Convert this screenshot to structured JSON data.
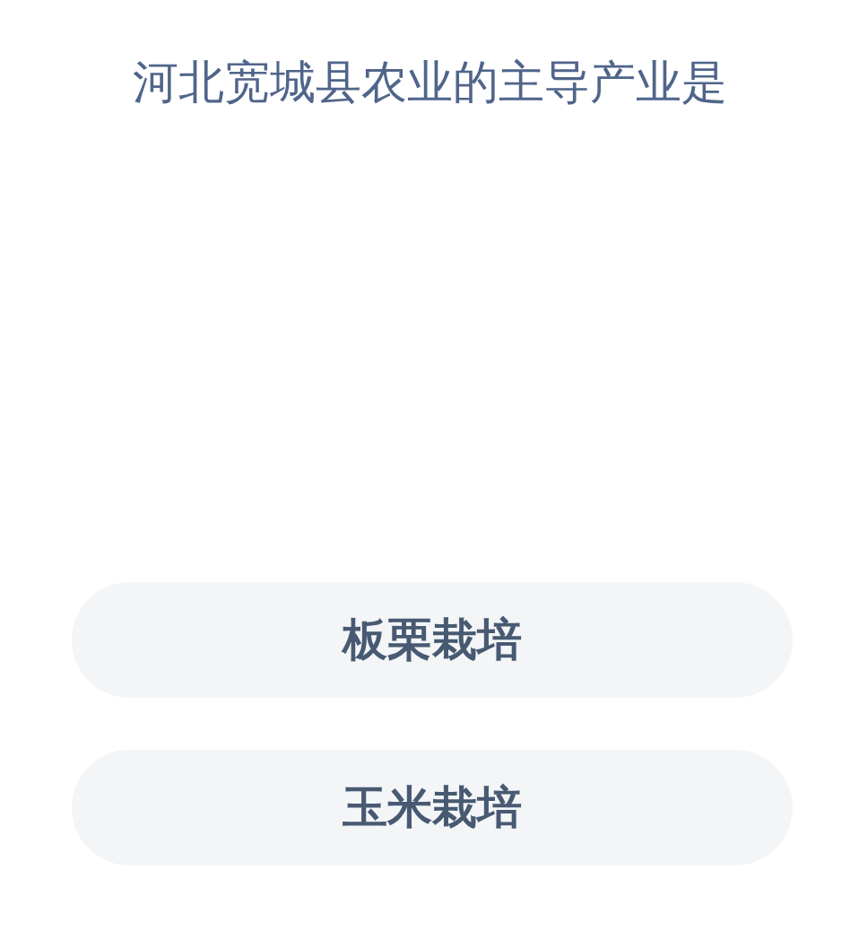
{
  "question": "河北宽城县农业的主导产业是",
  "options": [
    {
      "label": "板栗栽培"
    },
    {
      "label": "玉米栽培"
    }
  ]
}
